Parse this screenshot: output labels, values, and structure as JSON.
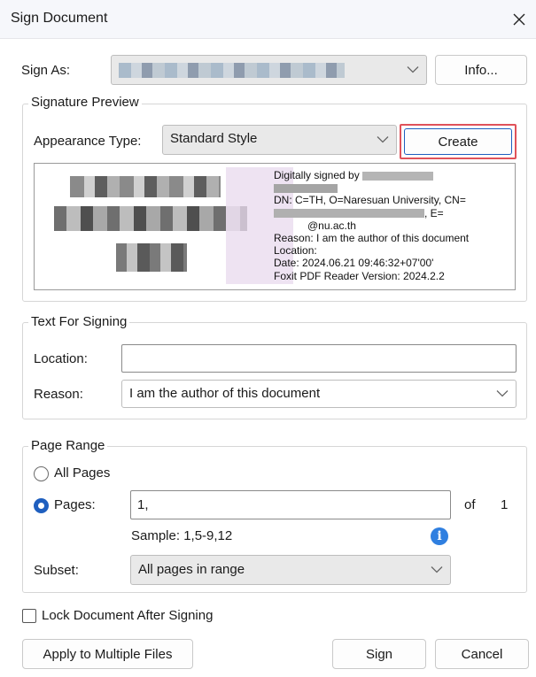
{
  "window": {
    "title": "Sign Document",
    "close_label": "✕"
  },
  "sign_as": {
    "label": "Sign As:",
    "value": "",
    "info_button": "Info..."
  },
  "signature_preview": {
    "legend": "Signature Preview",
    "appearance_label": "Appearance Type:",
    "appearance_value": "Standard Style",
    "create_button": "Create",
    "preview_lines": [
      "Digitally signed by",
      "",
      "DN: C=TH, O=Naresuan University, CN=",
      ", E=",
      "@nu.ac.th",
      "Reason: I am the author of this document",
      "Location:",
      "Date: 2024.06.21 09:46:32+07'00'",
      "Foxit PDF Reader Version: 2024.2.2"
    ]
  },
  "text_for_signing": {
    "legend": "Text For Signing",
    "location_label": "Location:",
    "location_value": "",
    "reason_label": "Reason:",
    "reason_value": "I am the author of this document"
  },
  "page_range": {
    "legend": "Page Range",
    "all_pages_label": "All Pages",
    "pages_label": "Pages:",
    "pages_value": "1,",
    "of_label": "of",
    "total_pages": "1",
    "sample_text": "Sample: 1,5-9,12",
    "subset_label": "Subset:",
    "subset_value": "All pages in range",
    "selected": "pages"
  },
  "lock_after_signing": {
    "label": "Lock Document After Signing",
    "checked": false
  },
  "buttons": {
    "apply_multiple": "Apply to Multiple Files",
    "sign": "Sign",
    "cancel": "Cancel"
  },
  "colors": {
    "accent": "#1f5fbf",
    "highlight": "#e0525a",
    "info": "#2f7fe0"
  }
}
